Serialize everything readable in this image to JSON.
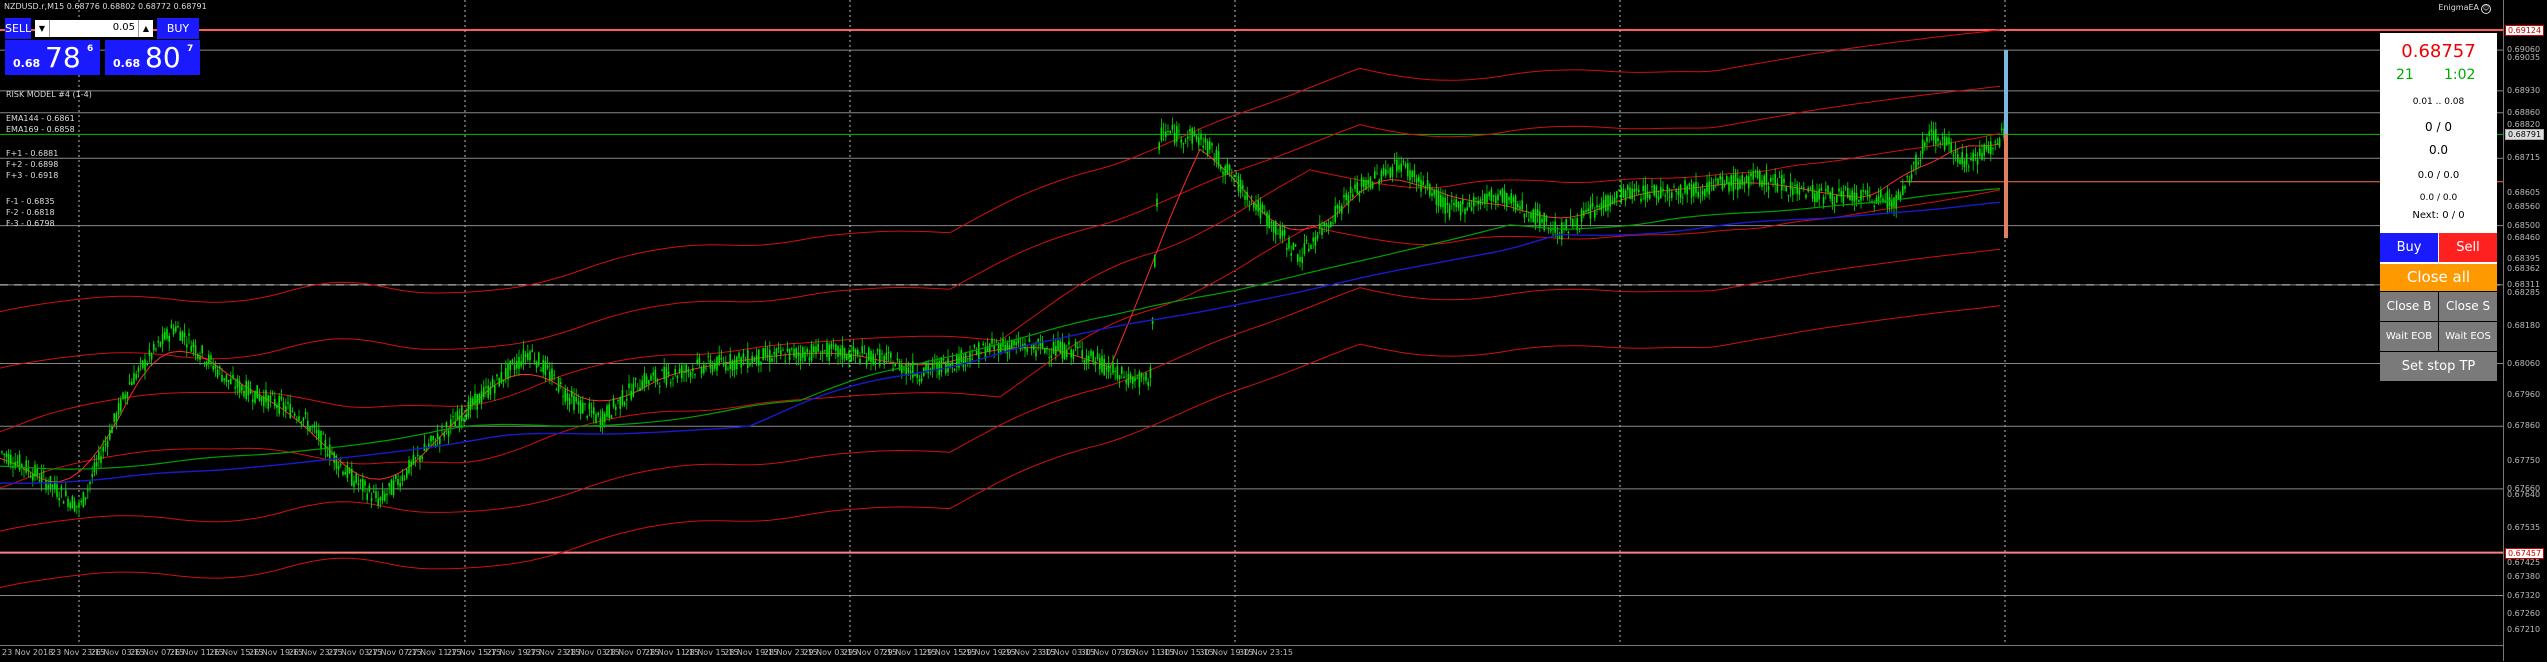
{
  "window": {
    "title": "NZDUSD.r,M15  0.68776 0.68802 0.68772 0.68791",
    "ea_name": "EnigmaEA"
  },
  "trade_panel": {
    "sell_label": "SELL",
    "buy_label": "BUY",
    "lot_value": "0.05",
    "sell_price": {
      "prefix": "0.68",
      "big": "78",
      "sup": "6"
    },
    "buy_price": {
      "prefix": "0.68",
      "big": "80",
      "sup": "7"
    }
  },
  "indicators": {
    "risk_model": "RISK MODEL #4 (1-4)",
    "ema144": "EMA144 - 0.6861",
    "ema169": "EMA169 - 0.6858",
    "fplus": [
      "F+1 - 0.6881",
      "F+2 - 0.6898",
      "F+3 - 0.6918"
    ],
    "fminus": [
      "F-1 - 0.6835",
      "F-2 - 0.6818",
      "F-3 - 0.6798"
    ]
  },
  "ea_panel": {
    "price": "0.68757",
    "count": "21",
    "timer": "1:02",
    "lot_range": "0.01 .. 0.08",
    "orders": "0 / 0",
    "profit": "0.0",
    "ratio1": "0.0 / 0.0",
    "ratio2": "0.0 / 0.0",
    "next": "Next: 0 / 0",
    "buy_label": "Buy",
    "sell_label": "Sell",
    "close_all_label": "Close all",
    "close_b_label": "Close B",
    "close_s_label": "Close S",
    "wait_eob_label": "Wait EOB",
    "wait_eos_label": "Wait EOS",
    "set_stop_tp_label": "Set stop TP"
  },
  "price_axis": {
    "labels": [
      "0.69124",
      "0.69060",
      "0.69035",
      "0.68930",
      "0.68860",
      "0.68820",
      "0.68791",
      "0.68715",
      "0.68605",
      "0.68560",
      "0.68500",
      "0.68460",
      "0.68395",
      "0.68362",
      "0.68311",
      "0.68285",
      "0.68180",
      "0.68060",
      "0.67960",
      "0.67860",
      "0.67750",
      "0.67660",
      "0.67640",
      "0.67535",
      "0.67457",
      "0.67425",
      "0.67380",
      "0.67320",
      "0.67260",
      "0.67210"
    ],
    "current_price": "0.68791",
    "high_marker": "0.69124",
    "low_marker": "0.67457"
  },
  "time_axis": {
    "labels": [
      "23 Nov 2018",
      "23 Nov 23:15",
      "26 Nov 03:15",
      "26 Nov 07:15",
      "26 Nov 11:15",
      "26 Nov 15:15",
      "26 Nov 19:15",
      "26 Nov 23:15",
      "27 Nov 03:15",
      "27 Nov 07:15",
      "27 Nov 11:15",
      "27 Nov 15:15",
      "27 Nov 19:15",
      "27 Nov 23:15",
      "28 Nov 03:15",
      "28 Nov 07:15",
      "28 Nov 11:15",
      "28 Nov 15:15",
      "28 Nov 19:15",
      "28 Nov 23:15",
      "29 Nov 03:15",
      "29 Nov 07:15",
      "29 Nov 11:15",
      "29 Nov 15:15",
      "29 Nov 19:15",
      "29 Nov 23:15",
      "30 Nov 03:15",
      "30 Nov 07:15",
      "30 Nov 11:15",
      "30 Nov 15:15",
      "30 Nov 19:15",
      "30 Nov 23:15"
    ]
  },
  "colors": {
    "background": "#000000",
    "candle": "#00e000",
    "ema144": "#00a000",
    "ema169": "#1a1acc",
    "bands": "#d01010",
    "button_blue": "#1a1aff",
    "sell_red": "#ff2020",
    "close_all_orange": "#ff9900"
  }
}
